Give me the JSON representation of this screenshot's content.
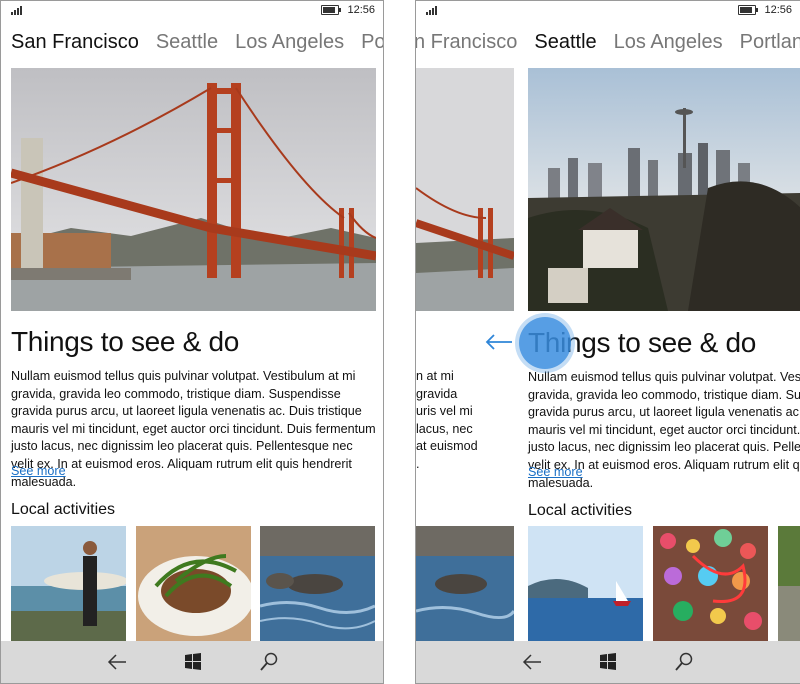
{
  "status": {
    "time": "12:56"
  },
  "left": {
    "tabs": [
      "San Francisco",
      "Seattle",
      "Los Angeles",
      "Portlan"
    ],
    "heading": "Things to see & do",
    "body": "Nullam euismod tellus quis pulvinar volutpat. Vestibulum at mi gravida, gravida leo commodo, tristique diam. Suspendisse gravida purus arcu, ut laoreet ligula venenatis ac. Duis tristique mauris vel mi tincidunt, eget auctor orci tincidunt. Duis fermentum justo lacus, nec dignissim leo placerat quis. Pellentesque nec velit ex. In at euismod eros. Aliquam rutrum elit quis hendrerit malesuada.",
    "see_more": "See more",
    "activities": "Local activities"
  },
  "right": {
    "tabs": [
      "n Francisco",
      "Seattle",
      "Los Angeles",
      "Portland"
    ],
    "heading": "Things to see & do",
    "body": "Nullam euismod tellus quis pulvinar volutpat. Vestibulum at mi gravida, gravida leo commodo, tristique diam. Suspendisse gravida purus arcu, ut laoreet ligula venenatis ac. Duis tristique mauris vel mi tincidunt, eget auctor orci tincidunt. Duis fermentum justo lacus, nec dignissim leo placerat quis. Pellentesque nec velit ex. In at euismod eros. Aliquam rutrum elit quis hendrerit malesuada.",
    "peek_lines": [
      "n at mi",
      "gravida",
      "uris vel mi",
      "lacus, nec",
      "at euismod",
      "."
    ],
    "see_more": "See more",
    "activities": "Local activities"
  },
  "icons": {
    "back": "back-arrow-icon",
    "start": "windows-start-icon",
    "search": "search-icon",
    "swipe": "swipe-left-arrow-icon",
    "touch": "touch-point-indicator"
  },
  "colors": {
    "link": "#1a6fc5",
    "touch": "#3a8ee0",
    "navbar": "#d9d9d9"
  }
}
